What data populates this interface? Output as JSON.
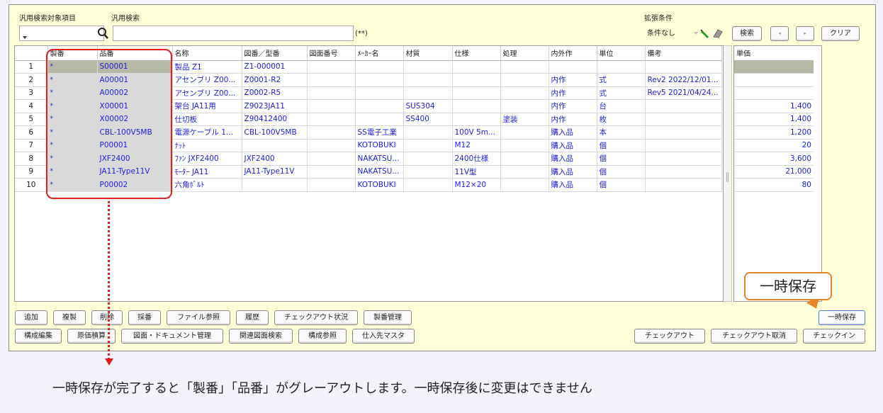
{
  "header": {
    "target_label": "汎用検索対象項目",
    "search_label": "汎用検索",
    "search_value": "",
    "search_hint": "(**)",
    "extended_label": "拡張条件",
    "condition_value": "条件なし",
    "search_button": "検索",
    "prev_button": "◂",
    "next_button": "▸",
    "clear_button": "クリア"
  },
  "grid": {
    "columns": [
      "",
      "製番",
      "品番",
      "名称",
      "図番／型番",
      "図面番号",
      "ﾒｰｶｰ名",
      "材質",
      "仕様",
      "処理",
      "内外作",
      "単位",
      "備考"
    ],
    "rows": [
      [
        "1",
        "*",
        "S00001",
        "製品 Z1",
        "Z1-000001",
        "",
        "",
        "",
        "",
        "",
        "",
        "",
        ""
      ],
      [
        "2",
        "*",
        "A00001",
        "アセンブリ Z00...",
        "Z0001-R2",
        "",
        "",
        "",
        "",
        "",
        "内作",
        "式",
        "Rev2 2022/12/01..."
      ],
      [
        "3",
        "*",
        "A00002",
        "アセンブリ Z00...",
        "Z0002-R5",
        "",
        "",
        "",
        "",
        "",
        "内作",
        "式",
        "Rev5 2021/04/24..."
      ],
      [
        "4",
        "*",
        "X00001",
        "架台 JA11用",
        "Z9023JA11",
        "",
        "",
        "SUS304",
        "",
        "",
        "内作",
        "台",
        ""
      ],
      [
        "5",
        "*",
        "X00002",
        "仕切板",
        "Z90412400",
        "",
        "",
        "SS400",
        "",
        "塗装",
        "内作",
        "枚",
        ""
      ],
      [
        "6",
        "*",
        "CBL-100V5MB",
        "電源ケーブル 1...",
        "CBL-100V5MB",
        "",
        "SS電子工業",
        "",
        "100V 5m...",
        "",
        "購入品",
        "本",
        ""
      ],
      [
        "7",
        "*",
        "P00001",
        "ﾅｯﾄ",
        "",
        "",
        "KOTOBUKI",
        "",
        "M12",
        "",
        "購入品",
        "個",
        ""
      ],
      [
        "8",
        "*",
        "JXF2400",
        "ﾌｧﾝ JXF2400",
        "JXF2400",
        "",
        "NAKATSU...",
        "",
        "2400仕様",
        "",
        "購入品",
        "個",
        ""
      ],
      [
        "9",
        "*",
        "JA11-Type11V",
        "ﾓｰﾀｰ JA11",
        "JA11-Type11V",
        "",
        "NAKATSU...",
        "",
        "11V型",
        "",
        "購入品",
        "個",
        ""
      ],
      [
        "10",
        "*",
        "P00002",
        "六角ﾎﾞﾙﾄ",
        "",
        "",
        "KOTOBUKI",
        "",
        "M12×20",
        "",
        "購入品",
        "個",
        ""
      ]
    ]
  },
  "price_grid": {
    "header": "単価",
    "values": [
      "",
      "",
      "",
      "1,400",
      "1,400",
      "1,200",
      "20",
      "3,600",
      "21,000",
      "80"
    ]
  },
  "buttons_row1": [
    "追加",
    "複製",
    "削除",
    "採番",
    "ファイル参照",
    "履歴",
    "チェックアウト状況",
    "製番管理"
  ],
  "buttons_row2": [
    "構成編集",
    "原価積算",
    "図面・ドキュメント管理",
    "関連図面検索",
    "構成参照",
    "仕入先マスタ"
  ],
  "right_buttons": {
    "temp_save": "一時保存",
    "checkout": "チェックアウト",
    "checkout_cancel": "チェックアウト取消",
    "checkin": "チェックイン"
  },
  "annotation": {
    "callout": "一時保存",
    "caption": "一時保存が完了すると「製番」「品番」がグレーアウトします。一時保存後に変更はできません"
  },
  "colors": {
    "window_bg": "#fefed9",
    "annotation_red": "#e02020",
    "callout_orange": "#e8852a",
    "cell_text_blue": "#1c1ce0",
    "grayed_cell": "#d9d9d9"
  }
}
